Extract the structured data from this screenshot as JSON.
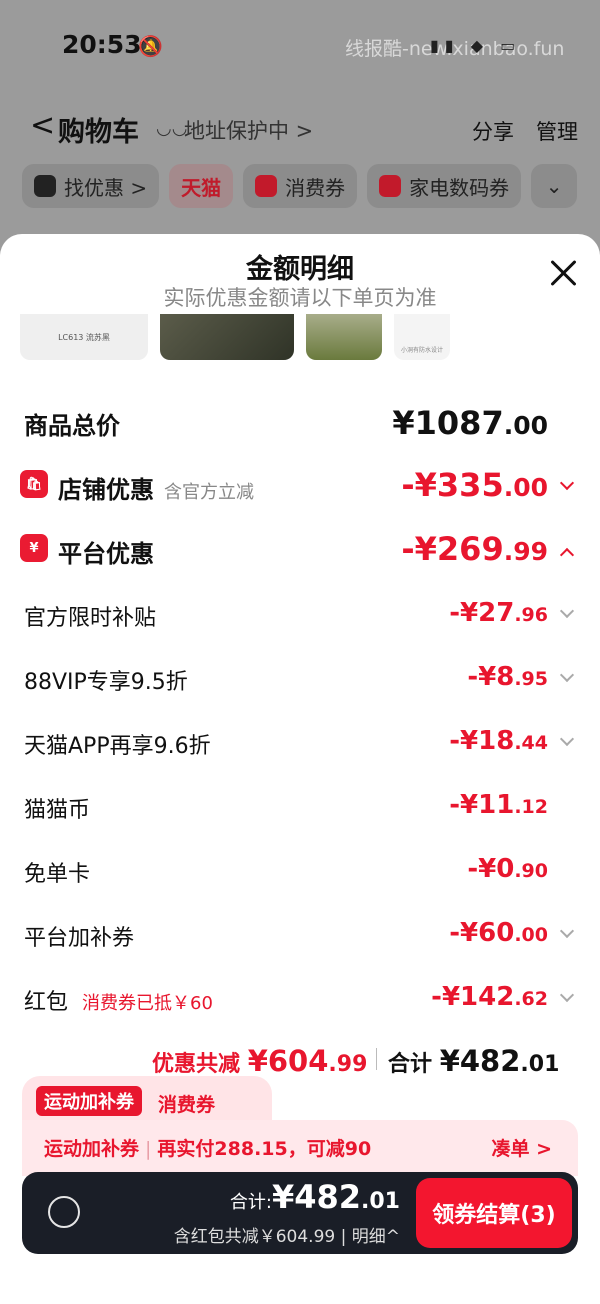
{
  "status_bar": {
    "time": "20:53",
    "watermark": "线报酷-new.xianbao.fun"
  },
  "nav": {
    "back": "<",
    "title": "购物车",
    "address_protect": "地址保护中 >",
    "share": "分享",
    "manage": "管理"
  },
  "chips": [
    {
      "label": "找优惠 >"
    },
    {
      "label": "天猫"
    },
    {
      "label": "消费券"
    },
    {
      "label": "家电数码券"
    }
  ],
  "sheet": {
    "title": "金额明细",
    "subtitle": "实际优惠金额请以下单页为准",
    "thumb_text_1": "LC613 流苏黑",
    "thumb_text_4": "小洞有防水设计",
    "total": {
      "label": "商品总价",
      "int": "¥1087",
      "dec": ".00"
    },
    "store": {
      "label": "店铺优惠",
      "note": "含官方立减",
      "int": "-¥335",
      "dec": ".00",
      "icon": "🛍"
    },
    "platform": {
      "label": "平台优惠",
      "int": "-¥269",
      "dec": ".99",
      "icon": "¥"
    },
    "items": [
      {
        "label": "官方限时补贴",
        "int": "-¥27",
        "dec": ".96"
      },
      {
        "label": "88VIP专享9.5折",
        "int": "-¥8",
        "dec": ".95"
      },
      {
        "label": "天猫APP再享9.6折",
        "int": "-¥18",
        "dec": ".44"
      },
      {
        "label": "猫猫币",
        "int": "-¥11",
        "dec": ".12"
      },
      {
        "label": "免单卡",
        "int": "-¥0",
        "dec": ".90"
      },
      {
        "label": "平台加补券",
        "int": "-¥60",
        "dec": ".00"
      },
      {
        "label": "红包",
        "note": "消费券已抵￥60",
        "int": "-¥142",
        "dec": ".62"
      }
    ],
    "summary": {
      "discount_label": "优惠共减",
      "discount_int": "¥604",
      "discount_dec": ".99",
      "total_label": "合计",
      "total_int": "¥482",
      "total_dec": ".01"
    }
  },
  "promo": {
    "tag": "运动加补券",
    "tab2": "消费券",
    "line_a": "运动加补券",
    "line_b": "再实付288.15，可减90",
    "link": "凑单 >"
  },
  "checkout_bar": {
    "total_label": "合计:",
    "total_int": "¥482",
    "total_dec": ".01",
    "detail": "含红包共减￥604.99 | 明细^",
    "button": "领券结算(3)"
  },
  "colors": {
    "accent": "#e8162e",
    "bar": "#1a1e27"
  }
}
